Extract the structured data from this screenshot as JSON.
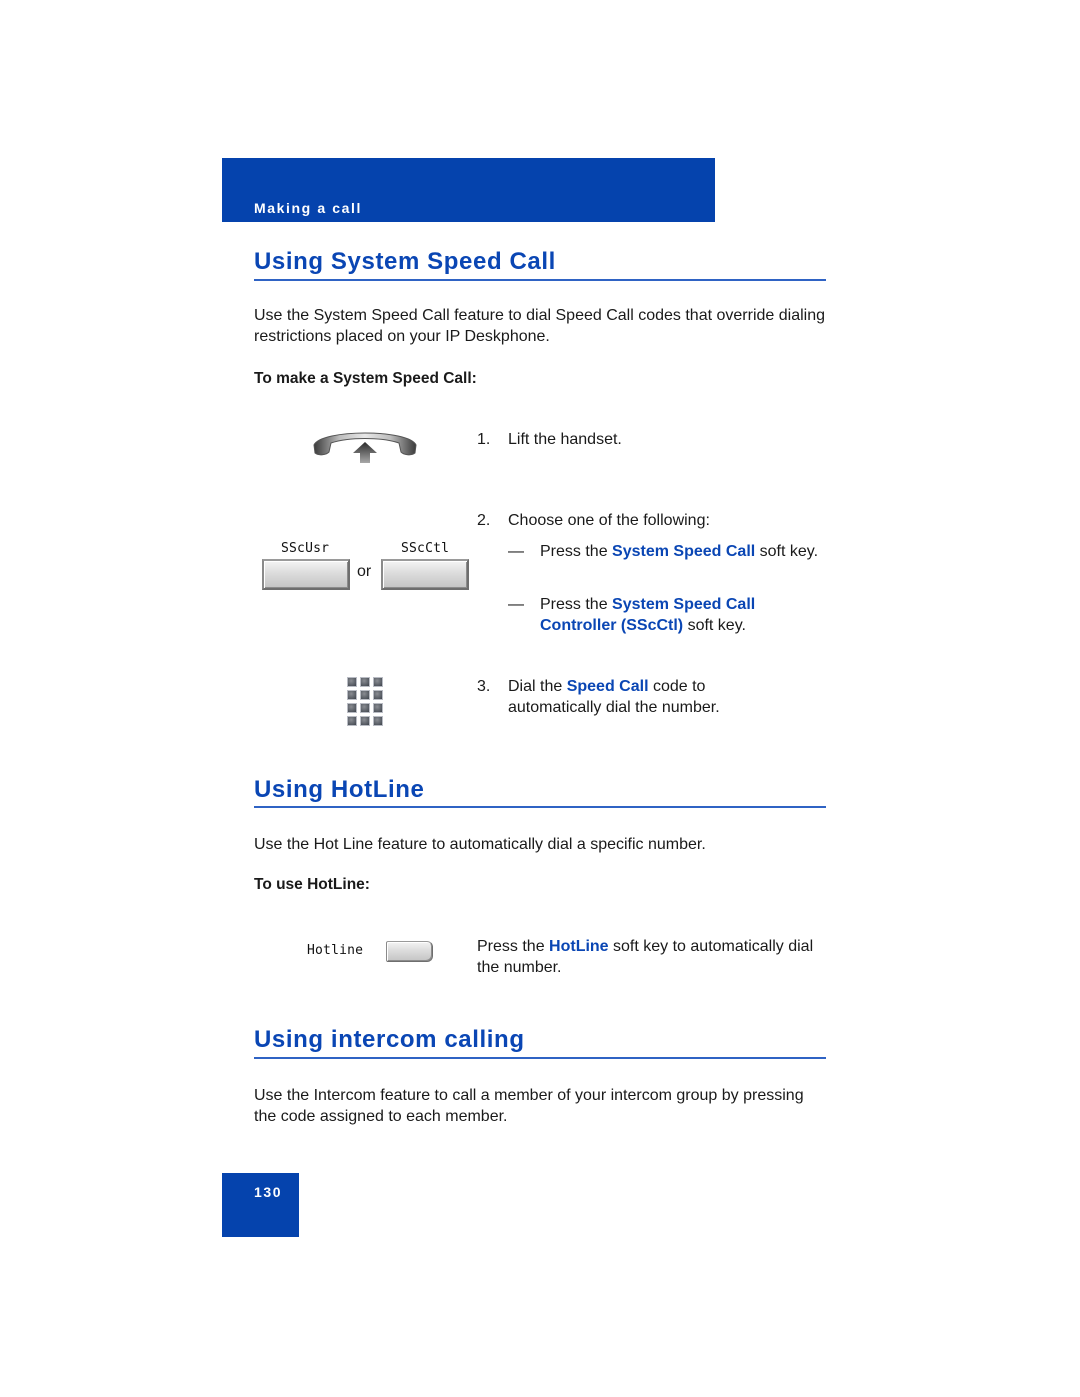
{
  "header": {
    "chapter": "Making a call"
  },
  "sections": [
    {
      "title": "Using System Speed Call",
      "intro": "Use the System Speed Call feature to dial Speed Call codes that override dialing restrictions placed on your IP Deskphone.",
      "procedure_label": "To make a System Speed Call:",
      "steps": [
        {
          "number": "1.",
          "text": "Lift the handset.",
          "icon": "handset-lift-icon"
        },
        {
          "number": "2.",
          "text": "Choose one of the following:",
          "options": [
            {
              "dash": "—",
              "prefix": "Press the ",
              "highlight": "System Speed Call",
              "suffix": " soft key."
            },
            {
              "dash": "—",
              "prefix": "Press the ",
              "highlight": "System Speed Call Controller (SScCtl)",
              "suffix": " soft key."
            }
          ],
          "softkeys": [
            {
              "label": "SScUsr"
            },
            {
              "label": "SScCtl"
            }
          ],
          "or_text": "or"
        },
        {
          "number": "3.",
          "prefix": "Dial the ",
          "highlight": "Speed Call",
          "suffix": " code to automatically dial the number.",
          "icon": "dialpad-icon"
        }
      ]
    },
    {
      "title": "Using HotLine",
      "intro": "Use the Hot Line feature to automatically dial a specific number.",
      "procedure_label": "To use HotLine:",
      "step": {
        "prefix": "Press the ",
        "highlight": "HotLine",
        "suffix": " soft key to automatically dial the number.",
        "softkey_label": "Hotline"
      }
    },
    {
      "title": "Using intercom calling",
      "intro": "Use the Intercom feature to call a member of your intercom group by pressing the code assigned to each member."
    }
  ],
  "footer": {
    "page_number": "130"
  },
  "colors": {
    "brand_blue": "#0543ad",
    "heading_blue": "#0a46b4"
  }
}
